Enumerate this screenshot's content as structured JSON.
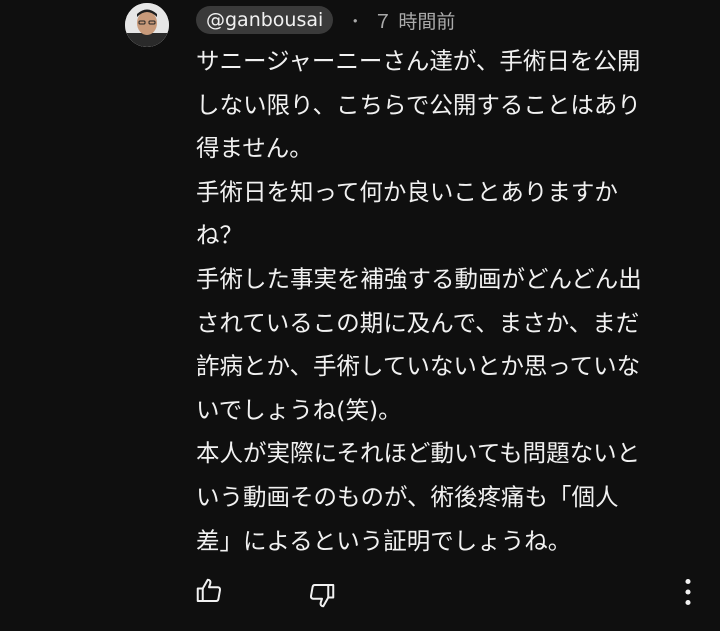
{
  "comment": {
    "author": "@ganbousai",
    "separator": "・",
    "timestamp": "７ 時間前",
    "lines": [
      "サニージャーニーさん達が、手術日を公開",
      "しない限り、こちらで公開することはあり",
      "得ません。",
      "手術日を知って何か良いことありますか",
      "ね？",
      "手術した事実を補強する動画がどんどん出",
      "されているこの期に及んで、まさか、まだ",
      "詐病とか、手術していないとか思っていな",
      "いでしょうね(笑)。",
      "本人が実際にそれほど動いても問題ないと",
      "いう動画そのものが、術後疼痛も「個人",
      "差」によるという証明でしょうね。"
    ]
  },
  "actions": {
    "like_icon": "thumbs-up-icon",
    "dislike_icon": "thumbs-down-icon",
    "more_icon": "more-vertical-icon"
  },
  "colors": {
    "background": "#0f0f0f",
    "text": "#f1f1f1",
    "secondary": "#aaaaaa",
    "chip": "#3a3a3a"
  }
}
